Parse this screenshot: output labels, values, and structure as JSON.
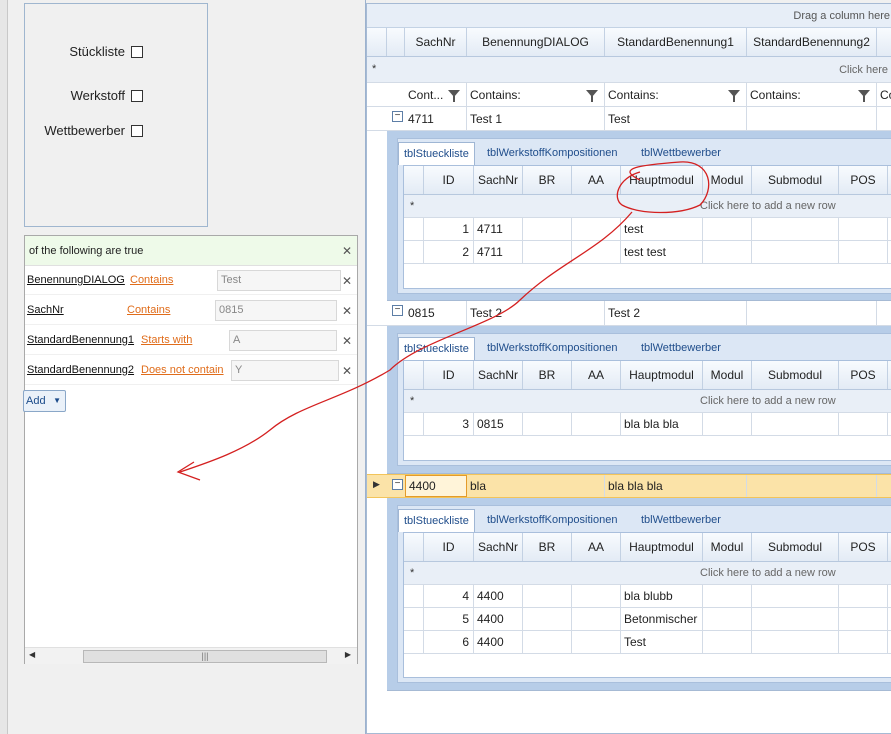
{
  "checkboxes": [
    {
      "label": "Stückliste",
      "checked": false
    },
    {
      "label": "Werkstoff",
      "checked": false
    },
    {
      "label": "Wettbewerber",
      "checked": false
    }
  ],
  "filter": {
    "header": "of the following are true",
    "rows": [
      {
        "field": "BenennungDIALOG",
        "op": "Contains",
        "value": "Test"
      },
      {
        "field": "SachNr",
        "op": "Contains",
        "value": "0815"
      },
      {
        "field": "StandardBenennung1",
        "op": "Starts with",
        "value": "A"
      },
      {
        "field": "StandardBenennung2",
        "op": "Does not contain",
        "value": "Y"
      }
    ],
    "add_label": "Add",
    "scroll_thumb": "|||"
  },
  "grid": {
    "group_panel": "Drag a column here",
    "columns": [
      "SachNr",
      "BenennungDIALOG",
      "StandardBenennung1",
      "StandardBenennung2"
    ],
    "add_new_row": "Click here",
    "filter_cells": [
      "Cont...",
      "Contains:",
      "Contains:",
      "Contains:",
      "Co"
    ],
    "detail_tabs": [
      "tblStueckliste",
      "tblWerkstoffKompositionen",
      "tblWettbewerber"
    ],
    "detail_columns": [
      "ID",
      "SachNr",
      "BR",
      "AA",
      "Hauptmodul",
      "Modul",
      "Submodul",
      "POS"
    ],
    "detail_add_row": "Click here to add a new row",
    "masters": [
      {
        "cells": [
          "4711",
          "Test 1",
          "Test",
          ""
        ],
        "selected": false,
        "details": [
          {
            "id": "1",
            "sachnr": "4711",
            "hauptmodul": "test"
          },
          {
            "id": "2",
            "sachnr": "4711",
            "hauptmodul": "test test"
          }
        ]
      },
      {
        "cells": [
          "0815",
          "Test 2",
          "Test 2",
          ""
        ],
        "selected": false,
        "details": [
          {
            "id": "3",
            "sachnr": "0815",
            "hauptmodul": "bla bla bla"
          }
        ]
      },
      {
        "cells": [
          "4400",
          "bla",
          "bla bla bla",
          ""
        ],
        "selected": true,
        "details": [
          {
            "id": "4",
            "sachnr": "4400",
            "hauptmodul": "bla blubb"
          },
          {
            "id": "5",
            "sachnr": "4400",
            "hauptmodul": "Betonmischer"
          },
          {
            "id": "6",
            "sachnr": "4400",
            "hauptmodul": "Test"
          }
        ]
      }
    ]
  },
  "colors": {
    "accent": "#1f4d8b",
    "filter_op": "#e06c1a",
    "selected_row": "#fbe3a8",
    "annotation": "#d42020"
  }
}
